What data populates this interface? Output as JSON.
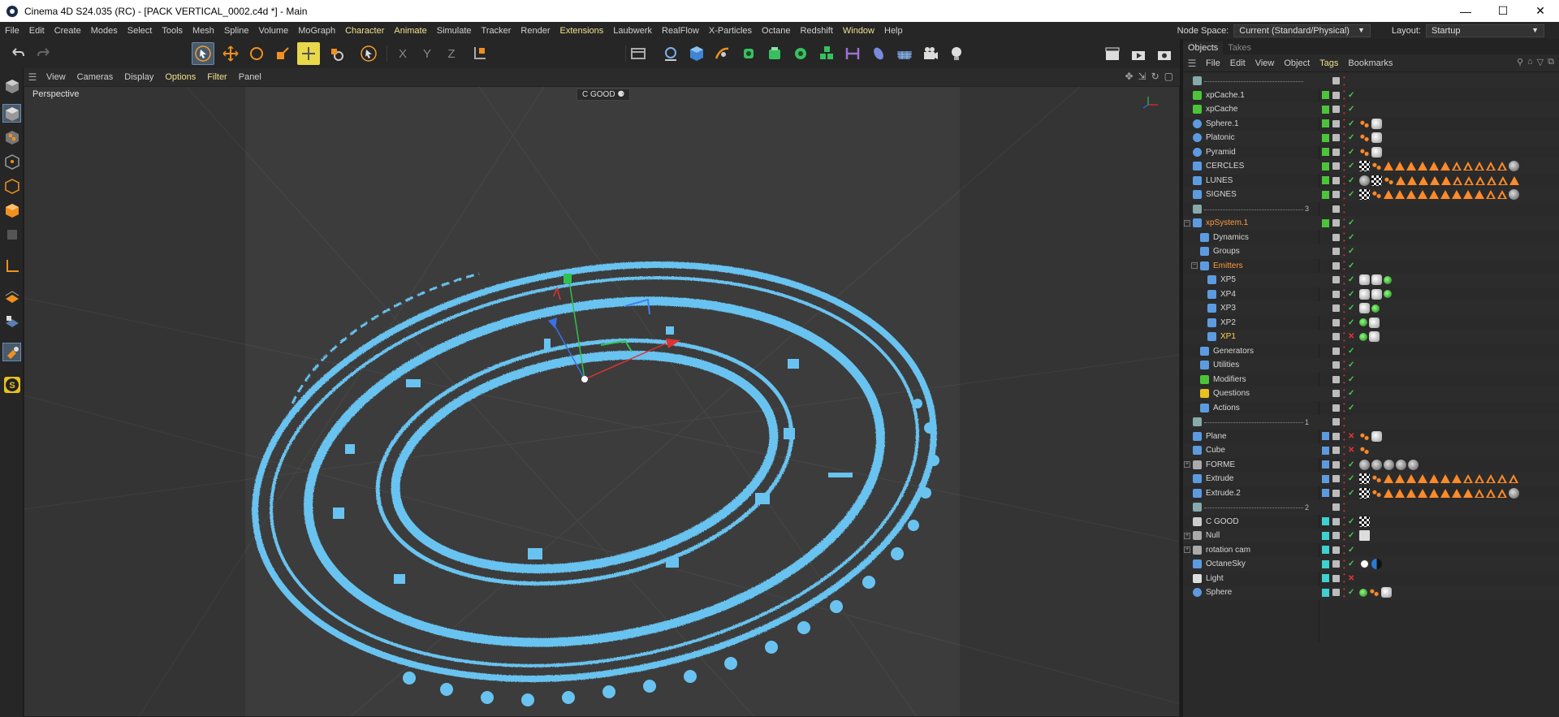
{
  "window": {
    "title": "Cinema 4D S24.035 (RC) - [PACK VERTICAL_0002.c4d *] - Main",
    "minimize": "—",
    "maximize": "☐",
    "close": "✕"
  },
  "menu": {
    "items": [
      "File",
      "Edit",
      "Create",
      "Modes",
      "Select",
      "Tools",
      "Mesh",
      "Spline",
      "Volume",
      "MoGraph",
      "Character",
      "Animate",
      "Simulate",
      "Tracker",
      "Render",
      "Extensions",
      "Laubwerk",
      "RealFlow",
      "X-Particles",
      "Octane",
      "Redshift",
      "Window",
      "Help"
    ],
    "node_space_label": "Node Space:",
    "node_space_value": "Current (Standard/Physical)",
    "layout_label": "Layout:",
    "layout_value": "Startup"
  },
  "toolbar": {
    "coord_x": "X",
    "coord_y": "Y",
    "coord_z": "Z"
  },
  "viewport": {
    "menu": [
      "View",
      "Cameras",
      "Display",
      "Options",
      "Filter",
      "Panel"
    ],
    "label": "Perspective",
    "camera_label": "C GOOD"
  },
  "panel": {
    "tabs": [
      "Objects",
      "Takes"
    ],
    "menu": [
      "File",
      "Edit",
      "View",
      "Object",
      "Tags",
      "Bookmarks"
    ]
  },
  "objects": [
    {
      "name": "",
      "type": "separator",
      "suffix": ""
    },
    {
      "name": "xpCache.1",
      "type": "cache"
    },
    {
      "name": "xpCache",
      "type": "cache"
    },
    {
      "name": "Sphere.1",
      "type": "sphere"
    },
    {
      "name": "Platonic",
      "type": "sphere"
    },
    {
      "name": "Pyramid",
      "type": "sphere"
    },
    {
      "name": "CERCLES",
      "type": "fracture"
    },
    {
      "name": "LUNES",
      "type": "fracture"
    },
    {
      "name": "SIGNES",
      "type": "fracture"
    },
    {
      "name": "",
      "type": "separator",
      "suffix": "3"
    },
    {
      "name": "xpSystem.1",
      "type": "system"
    },
    {
      "name": "Dynamics",
      "type": "folder"
    },
    {
      "name": "Groups",
      "type": "folder"
    },
    {
      "name": "Emitters",
      "type": "folder"
    },
    {
      "name": "XP5",
      "type": "emitter"
    },
    {
      "name": "XP4",
      "type": "emitter"
    },
    {
      "name": "XP3",
      "type": "emitter"
    },
    {
      "name": "XP2",
      "type": "emitter"
    },
    {
      "name": "XP1",
      "type": "emitter"
    },
    {
      "name": "Generators",
      "type": "folder"
    },
    {
      "name": "Utilities",
      "type": "folder"
    },
    {
      "name": "Modifiers",
      "type": "folder"
    },
    {
      "name": "Questions",
      "type": "folder"
    },
    {
      "name": "Actions",
      "type": "folder"
    },
    {
      "name": "",
      "type": "separator",
      "suffix": "1"
    },
    {
      "name": "Plane",
      "type": "plane"
    },
    {
      "name": "Cube",
      "type": "cube"
    },
    {
      "name": "FORME",
      "type": "null"
    },
    {
      "name": "Extrude",
      "type": "fracture"
    },
    {
      "name": "Extrude.2",
      "type": "fracture"
    },
    {
      "name": "",
      "type": "separator",
      "suffix": "2"
    },
    {
      "name": "C GOOD",
      "type": "camera"
    },
    {
      "name": "Null",
      "type": "null"
    },
    {
      "name": "rotation cam",
      "type": "null"
    },
    {
      "name": "OctaneSky",
      "type": "sky"
    },
    {
      "name": "Light",
      "type": "light"
    },
    {
      "name": "Sphere",
      "type": "sphere"
    }
  ],
  "colors": {
    "particles": "#69c3f0",
    "layer_green": "#4cc43a",
    "layer_blue": "#5d9be0",
    "layer_cyan": "#3fd0d0",
    "accent_yellow": "#e8d84a",
    "accent_orange": "#ff8a2a"
  }
}
